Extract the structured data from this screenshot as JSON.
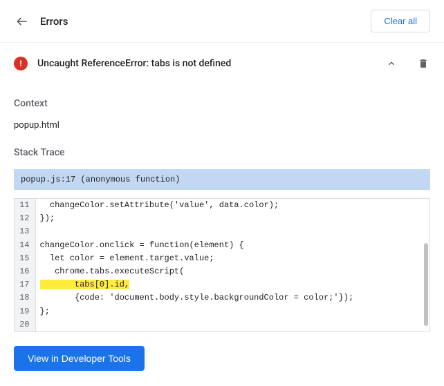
{
  "header": {
    "title": "Errors",
    "clear_all_label": "Clear all"
  },
  "error": {
    "message": "Uncaught ReferenceError: tabs is not defined"
  },
  "context": {
    "label": "Context",
    "value": "popup.html"
  },
  "stack_trace": {
    "label": "Stack Trace",
    "location": "popup.js:17 (anonymous function)"
  },
  "code": {
    "lines": [
      {
        "num": "11",
        "text": "  changeColor.setAttribute('value', data.color);",
        "highlight": false
      },
      {
        "num": "12",
        "text": "});",
        "highlight": false
      },
      {
        "num": "13",
        "text": "",
        "highlight": false
      },
      {
        "num": "14",
        "text": "changeColor.onclick = function(element) {",
        "highlight": false
      },
      {
        "num": "15",
        "text": "  let color = element.target.value;",
        "highlight": false
      },
      {
        "num": "16",
        "text": "   chrome.tabs.executeScript(",
        "highlight": false
      },
      {
        "num": "17",
        "text": "       tabs[0].id,",
        "highlight": true
      },
      {
        "num": "18",
        "text": "       {code: 'document.body.style.backgroundColor = color;'});",
        "highlight": false
      },
      {
        "num": "19",
        "text": "};",
        "highlight": false
      },
      {
        "num": "20",
        "text": "",
        "highlight": false
      }
    ]
  },
  "footer": {
    "view_devtools_label": "View in Developer Tools"
  }
}
